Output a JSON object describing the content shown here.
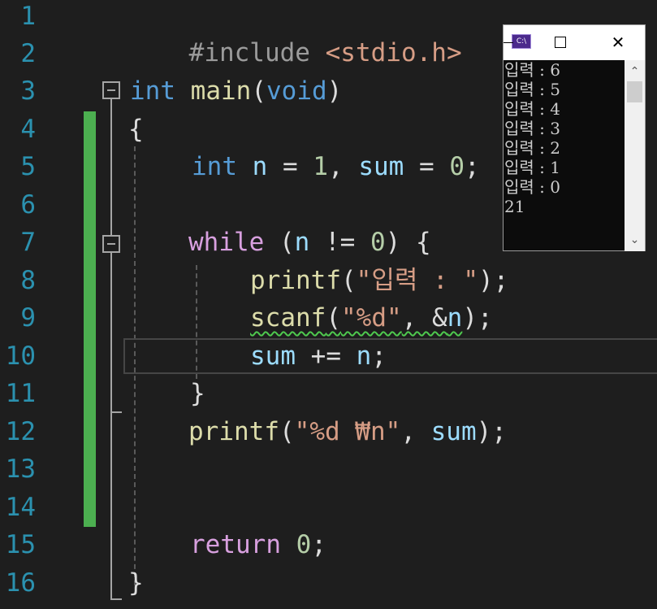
{
  "editor": {
    "line_numbers": [
      "1",
      "2",
      "3",
      "4",
      "5",
      "6",
      "7",
      "8",
      "9",
      "10",
      "11",
      "12",
      "13",
      "14",
      "15",
      "16"
    ],
    "code": {
      "l1_directive": "#include",
      "l1_header": "<stdio.h>",
      "l3_type": "int",
      "l3_func": "main",
      "l3_open": "(",
      "l3_param": "void",
      "l3_close": ")",
      "l4_brace": "{",
      "l5_type": "int",
      "l5_var_n": "n",
      "l5_eq1": " = ",
      "l5_one": "1",
      "l5_comma": ", ",
      "l5_var_sum": "sum",
      "l5_eq2": " = ",
      "l5_zero": "0",
      "l5_semi": ";",
      "l7_while": "while",
      "l7_open": " (",
      "l7_n": "n",
      "l7_op": " != ",
      "l7_zero": "0",
      "l7_close": ") {",
      "l8_func": "printf",
      "l8_open": "(",
      "l8_str": "\"입력 : \"",
      "l8_close": ");",
      "l9_func": "scanf",
      "l9_open": "(",
      "l9_str": "\"%d\"",
      "l9_mid": ", &",
      "l9_n": "n",
      "l9_close": ");",
      "l10_sum": "sum",
      "l10_op": " += ",
      "l10_n": "n",
      "l10_semi": ";",
      "l11_brace": "}",
      "l12_func": "printf",
      "l12_open": "(",
      "l12_str": "\"%d ₩n\"",
      "l12_comma": ", ",
      "l12_sum": "sum",
      "l12_close": ");",
      "l15_return": "return",
      "l15_space": " ",
      "l15_zero": "0",
      "l15_semi": ";",
      "l16_brace": "}"
    }
  },
  "console": {
    "icon_label": "C:\\",
    "close_glyph": "✕",
    "scroll_up": "⌃",
    "scroll_down": "⌄",
    "output_lines": [
      "입력 : 6",
      "입력 : 5",
      "입력 : 4",
      "입력 : 3",
      "입력 : 2",
      "입력 : 1",
      "입력 : 0",
      "21"
    ]
  },
  "colors": {
    "background": "#1e1e1e",
    "keyword": "#569cd6",
    "control": "#d8a0df",
    "function": "#dcdcaa",
    "variable": "#9cdcfe",
    "number": "#b5cea8",
    "string": "#d69d85",
    "line_number": "#2b91af",
    "change_bar": "#4caf50"
  }
}
